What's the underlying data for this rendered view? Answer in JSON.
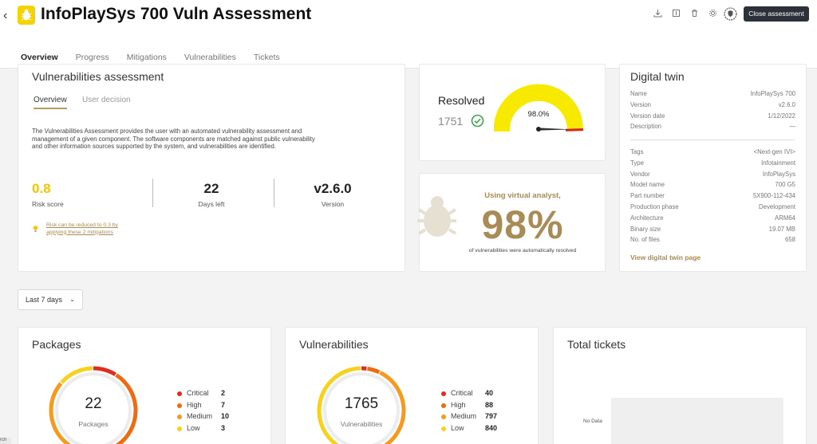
{
  "header": {
    "back_icon": "chevron-left-icon",
    "title": "InfoPlaySys 700 Vuln Assessment",
    "icons": [
      "download-icon",
      "export-icon",
      "trash-icon",
      "gear-icon",
      "shield-badge-icon"
    ],
    "close_label": "Close assessment"
  },
  "tabs": [
    {
      "label": "Overview",
      "active": true
    },
    {
      "label": "Progress"
    },
    {
      "label": "Mitigations"
    },
    {
      "label": "Vulnerabilities"
    },
    {
      "label": "Tickets"
    }
  ],
  "assessment": {
    "title": "Vulnerabilities assessment",
    "subtabs": [
      "Overview",
      "User decision"
    ],
    "description": "The Vulnerabilities Assessment provides the user with an automated vulnerability assessment and management of a given component. The software components are matched against public vulnerability and other information sources supported by the system, and vulnerabilities are identified.",
    "stats": [
      {
        "value": "0.8",
        "label": "Risk score",
        "color": "#f2c500"
      },
      {
        "value": "22",
        "label": "Days left"
      },
      {
        "value": "v2.6.0",
        "label": "Version"
      }
    ],
    "tip_line1": "Risk can be reduced to 0.3 by",
    "tip_line2": "applying these 2 mitigations"
  },
  "resolved": {
    "label": "Resolved",
    "count": "1751",
    "percent_text": "98.0%",
    "percent_value": 0.98,
    "gauge_color": "#f7ea00",
    "danger_color": "#d9261c"
  },
  "virtual_analyst": {
    "heading": "Using virtual analyst,",
    "big": "98%",
    "footer": "of vulnerabilities were automatically resolved"
  },
  "digital_twin": {
    "title": "Digital twin",
    "rows_top": [
      {
        "k": "Name",
        "v": "InfoPlaySys 700"
      },
      {
        "k": "Version",
        "v": "v2.6.0"
      },
      {
        "k": "Version date",
        "v": "1/12/2022"
      },
      {
        "k": "Description",
        "v": "—"
      }
    ],
    "rows_bottom": [
      {
        "k": "Tags",
        "v": "<Next-gen IVI>"
      },
      {
        "k": "Type",
        "v": "Infotainment"
      },
      {
        "k": "Vendor",
        "v": "InfoPlaySys"
      },
      {
        "k": "Model name",
        "v": "700 G5"
      },
      {
        "k": "Part number",
        "v": "5X900-112-434"
      },
      {
        "k": "Production phase",
        "v": "Development"
      },
      {
        "k": "Architecture",
        "v": "ARM64"
      },
      {
        "k": "Binary size",
        "v": "19.07 MB"
      },
      {
        "k": "No. of files",
        "v": "658"
      }
    ],
    "link": "View digital twin page"
  },
  "range": {
    "label": "Last 7 days",
    "icon": "chevron-down-icon"
  },
  "colors": {
    "critical": "#e02d20",
    "high": "#f06a0f",
    "medium": "#f59a1c",
    "low": "#f7d11c",
    "accent": "#a88b55"
  },
  "packages": {
    "title": "Packages",
    "total": "22",
    "center_label": "Packages",
    "legend": [
      {
        "name": "Critical",
        "value": 2,
        "display": "2"
      },
      {
        "name": "High",
        "value": 7,
        "display": "7"
      },
      {
        "name": "Medium",
        "value": 10,
        "display": "10"
      },
      {
        "name": "Low",
        "value": 3,
        "display": "3"
      }
    ]
  },
  "vulnerabilities": {
    "title": "Vulnerabilities",
    "total": "1765",
    "center_label": "Vulnerabilities",
    "legend": [
      {
        "name": "Critical",
        "value": 40,
        "display": "40"
      },
      {
        "name": "High",
        "value": 88,
        "display": "88"
      },
      {
        "name": "Medium",
        "value": 797,
        "display": "797"
      },
      {
        "name": "Low",
        "value": 840,
        "display": "840"
      }
    ]
  },
  "tickets": {
    "title": "Total tickets",
    "no_data": "No Data"
  },
  "search_stub": "rch"
}
